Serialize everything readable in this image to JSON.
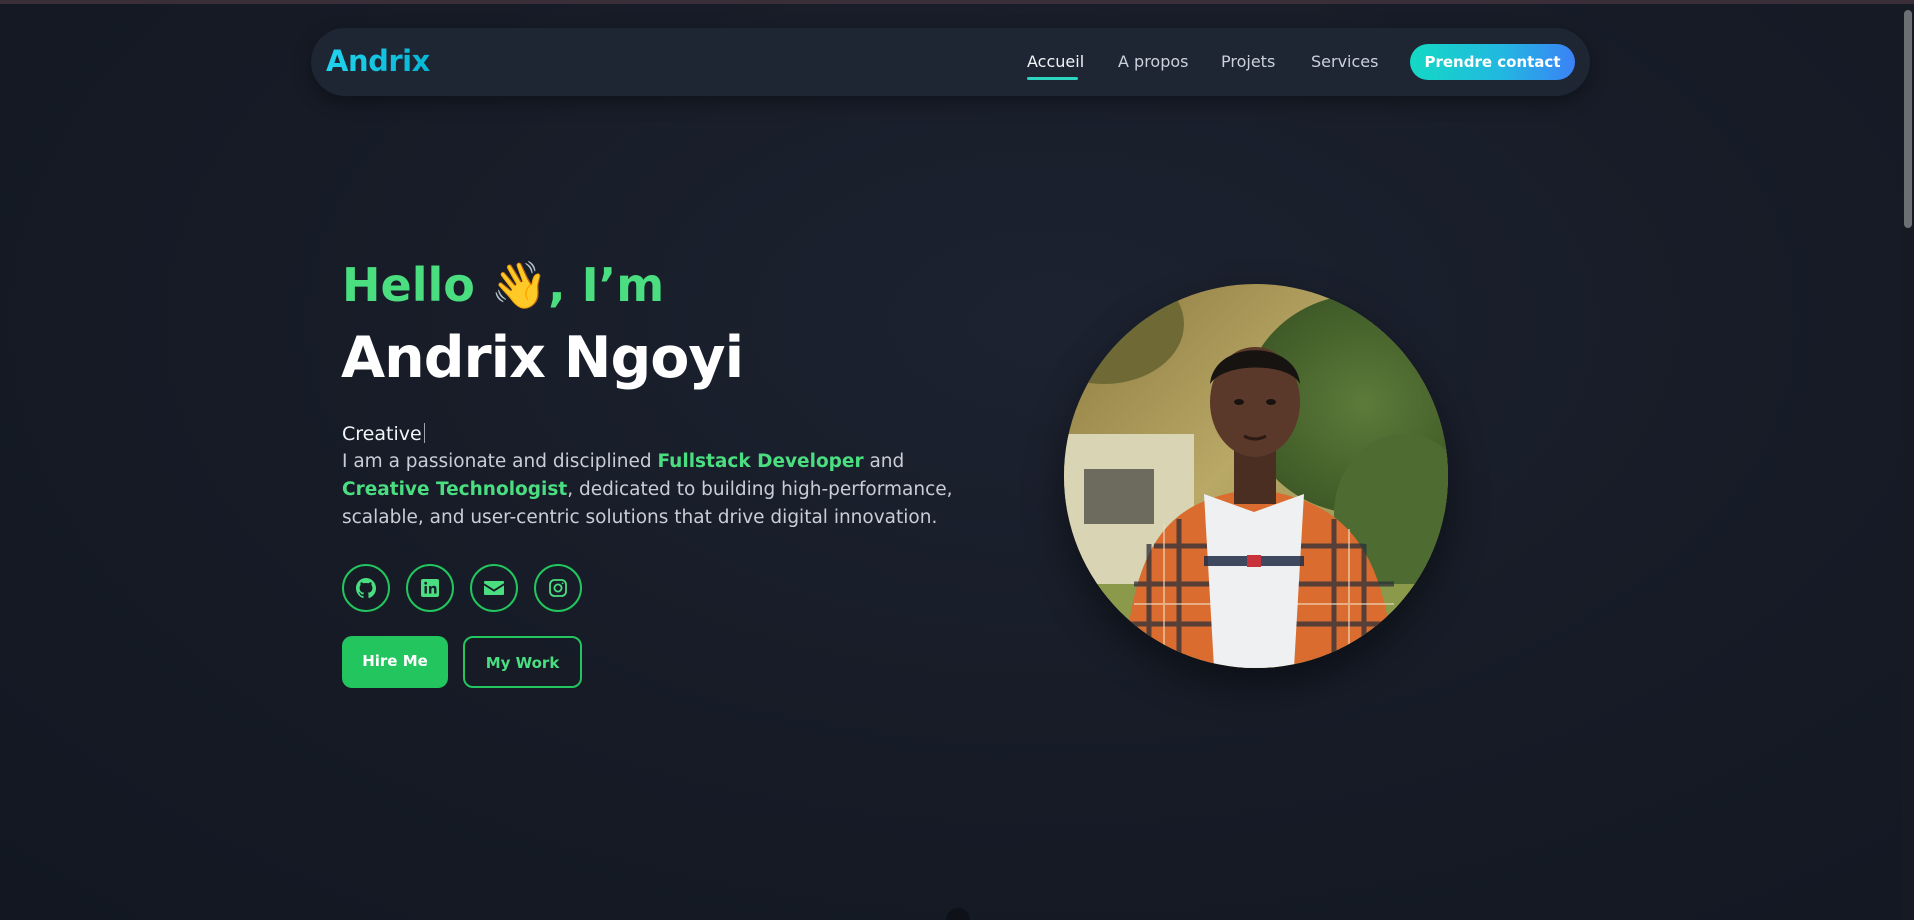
{
  "brand": "Andrix",
  "nav": {
    "items": [
      {
        "label": "Accueil",
        "active": true
      },
      {
        "label": "A propos",
        "active": false
      },
      {
        "label": "Projets",
        "active": false
      },
      {
        "label": "Services",
        "active": false
      }
    ],
    "cta_label": "Prendre contact"
  },
  "hero": {
    "greeting": "Hello 👋, I’m",
    "name": "Andrix Ngoyi",
    "typed_word": "Creative",
    "bio": {
      "intro": "I am a passionate and disciplined ",
      "role1": "Fullstack Developer",
      "connector": " and ",
      "role2": "Creative Technologist",
      "outro": ", dedicated to building high-performance, scalable, and user-centric solutions that drive digital innovation."
    },
    "socials": [
      "github-icon",
      "linkedin-icon",
      "mail-icon",
      "instagram-icon"
    ],
    "primary_button": "Hire Me",
    "secondary_button": "My Work"
  },
  "colors": {
    "accent_green": "#22c55e",
    "brand_cyan": "#22d3ee",
    "background": "#161b26"
  }
}
